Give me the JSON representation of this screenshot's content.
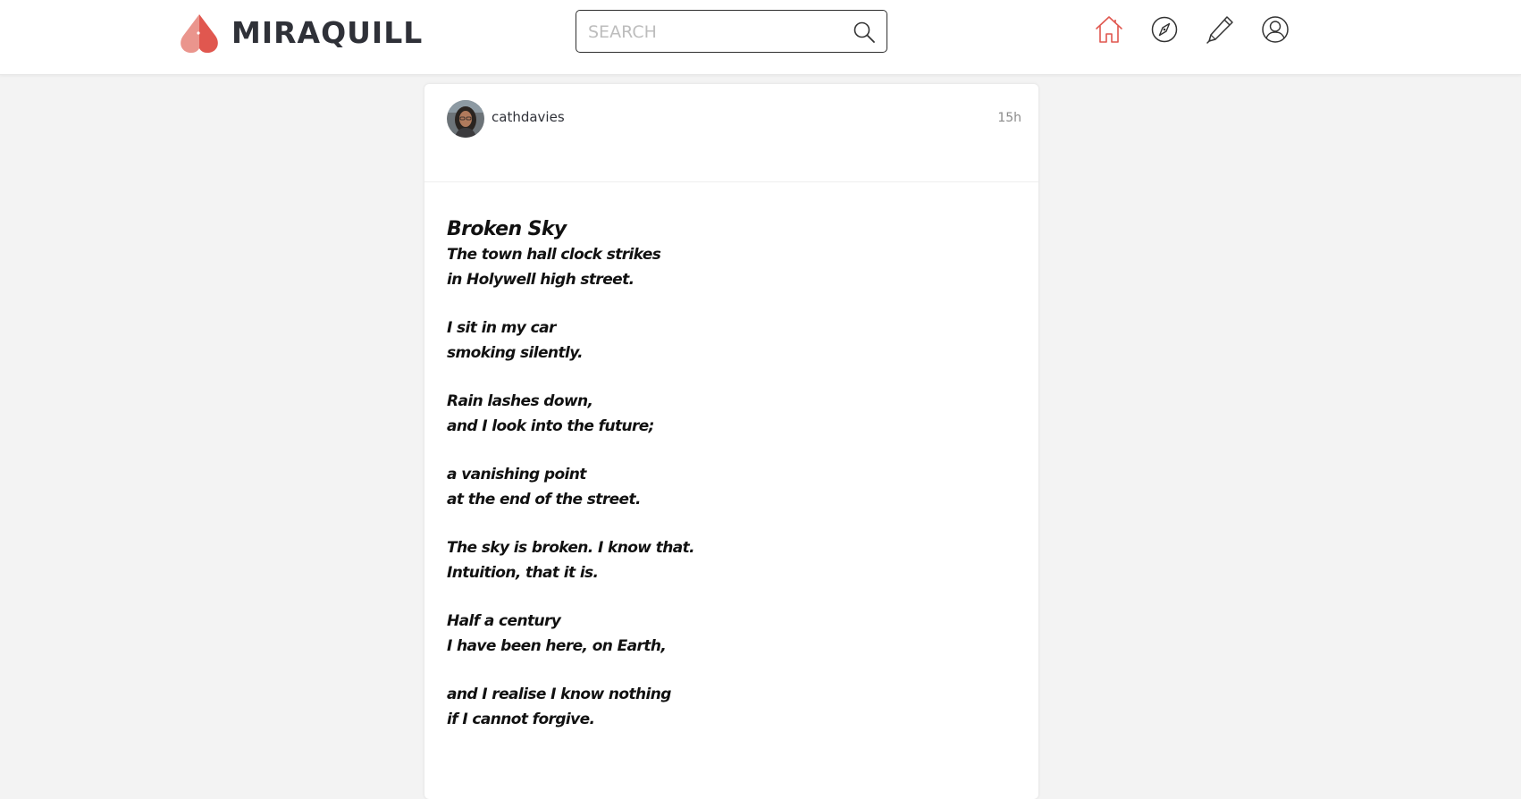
{
  "app": {
    "brand_name": "MIRAQUILL",
    "accent_color": "#e0574f"
  },
  "search": {
    "placeholder": "SEARCH"
  },
  "nav": {
    "items": [
      {
        "name": "home",
        "icon": "home-icon",
        "active": true
      },
      {
        "name": "explore",
        "icon": "compass-icon",
        "active": false
      },
      {
        "name": "write",
        "icon": "pen-icon",
        "active": false
      },
      {
        "name": "profile",
        "icon": "user-icon",
        "active": false
      }
    ]
  },
  "post": {
    "author": "cathdavies",
    "time_ago": "15h",
    "title": "Broken Sky",
    "stanzas": [
      [
        "The town hall clock strikes",
        "in Holywell high street."
      ],
      [
        "I sit in my car",
        "smoking silently."
      ],
      [
        "Rain lashes down,",
        "and I look into the future;"
      ],
      [
        "a vanishing point",
        "at the end of the street."
      ],
      [
        "The sky is broken. I know that.",
        "Intuition, that it is."
      ],
      [
        "Half a century",
        "I have been here, on Earth,"
      ],
      [
        "and I realise I know nothing",
        "if I cannot forgive."
      ]
    ]
  }
}
